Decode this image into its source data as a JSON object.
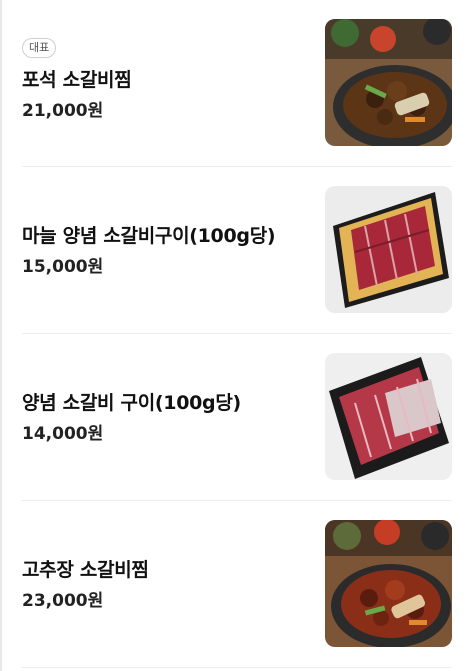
{
  "menu": {
    "items": [
      {
        "badge": "대표",
        "name": "포석 소갈비찜",
        "price": "21,000원",
        "image": "braised-short-ribs-photo"
      },
      {
        "name": "마늘 양념 소갈비구이(100g당)",
        "price": "15,000원",
        "image": "garlic-marinated-ribs-photo"
      },
      {
        "name": "양념 소갈비 구이(100g당)",
        "price": "14,000원",
        "image": "marinated-grilled-ribs-photo"
      },
      {
        "name": "고추장 소갈비찜",
        "price": "23,000원",
        "image": "gochujang-braised-ribs-photo"
      }
    ]
  },
  "colors": {
    "text": "#111111",
    "divider": "#ededed",
    "badge_border": "#cfcfcf"
  }
}
